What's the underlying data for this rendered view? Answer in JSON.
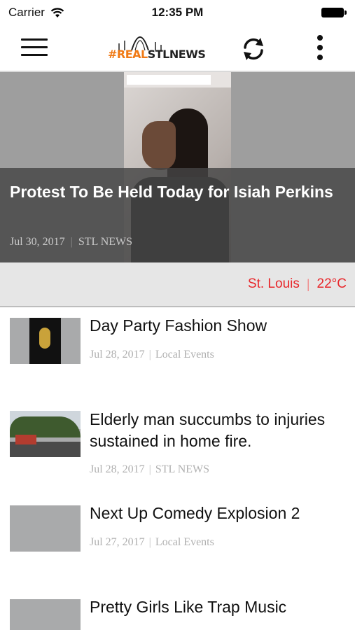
{
  "status_bar": {
    "carrier": "Carrier",
    "time": "12:35 PM"
  },
  "header": {
    "logo_hash": "#REAL",
    "logo_stl": "STLNEWS",
    "icons": [
      "menu-icon",
      "refresh-icon",
      "more-vertical-icon"
    ]
  },
  "featured": {
    "title": "Protest To Be Held Today for Isiah Perkins",
    "date": "Jul 30, 2017",
    "category": "STL NEWS"
  },
  "weather": {
    "city": "St. Louis",
    "temperature": "22°C",
    "color": "#e8262a"
  },
  "articles": [
    {
      "title": "Day Party Fashion Show",
      "date": "Jul 28, 2017",
      "category": "Local Events"
    },
    {
      "title": "Elderly man succumbs to injuries sustained in home fire.",
      "date": "Jul 28, 2017",
      "category": "STL NEWS"
    },
    {
      "title": "Next Up Comedy Explosion 2",
      "date": "Jul 27, 2017",
      "category": "Local Events"
    },
    {
      "title": "Pretty Girls Like Trap Music",
      "date": "",
      "category": ""
    }
  ],
  "meta_separator": "|",
  "colors": {
    "accent_orange": "#f07a15",
    "weather_red": "#e8262a",
    "hero_overlay": "#444444"
  }
}
